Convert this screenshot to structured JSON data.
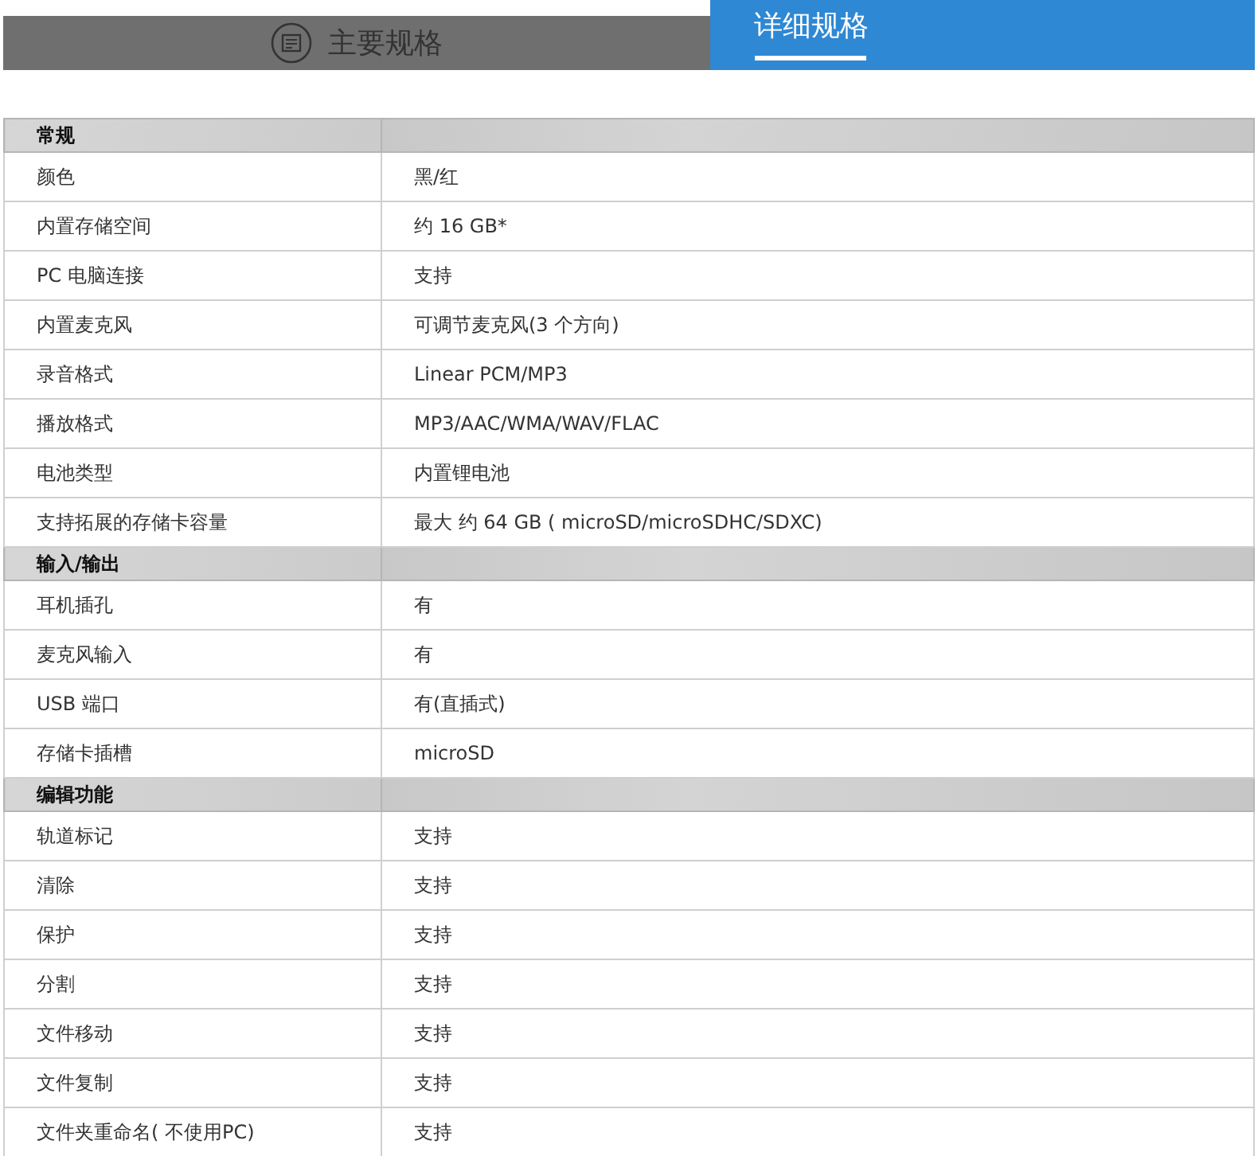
{
  "tabs": [
    {
      "label": "主要规格",
      "selected": false,
      "icon": true
    },
    {
      "label": "详细规格",
      "selected": true,
      "icon": false
    }
  ],
  "sections": [
    {
      "title": "常规",
      "rows": [
        {
          "label": "颜色",
          "value": "黑/红"
        },
        {
          "label": "内置存储空间",
          "value": "约 16 GB*"
        },
        {
          "label": "PC 电脑连接",
          "value": "支持"
        },
        {
          "label": "内置麦克风",
          "value": "可调节麦克风(3 个方向)"
        },
        {
          "label": "录音格式",
          "value": "Linear PCM/MP3"
        },
        {
          "label": "播放格式",
          "value": "MP3/AAC/WMA/WAV/FLAC"
        },
        {
          "label": "电池类型",
          "value": "内置锂电池"
        },
        {
          "label": "支持拓展的存储卡容量",
          "value": "最大 约 64 GB ( microSD/microSDHC/SDXC)"
        }
      ]
    },
    {
      "title": "输入/输出",
      "rows": [
        {
          "label": "耳机插孔",
          "value": "有"
        },
        {
          "label": "麦克风输入",
          "value": "有"
        },
        {
          "label": "USB 端口",
          "value": "有(直插式)"
        },
        {
          "label": "存储卡插槽",
          "value": "microSD"
        }
      ]
    },
    {
      "title": "编辑功能",
      "rows": [
        {
          "label": "轨道标记",
          "value": "支持"
        },
        {
          "label": "清除",
          "value": "支持"
        },
        {
          "label": "保护",
          "value": "支持"
        },
        {
          "label": "分割",
          "value": "支持"
        },
        {
          "label": "文件移动",
          "value": "支持"
        },
        {
          "label": "文件复制",
          "value": "支持"
        },
        {
          "label": "文件夹重命名( 不使用PC)",
          "value": "支持"
        }
      ]
    }
  ]
}
